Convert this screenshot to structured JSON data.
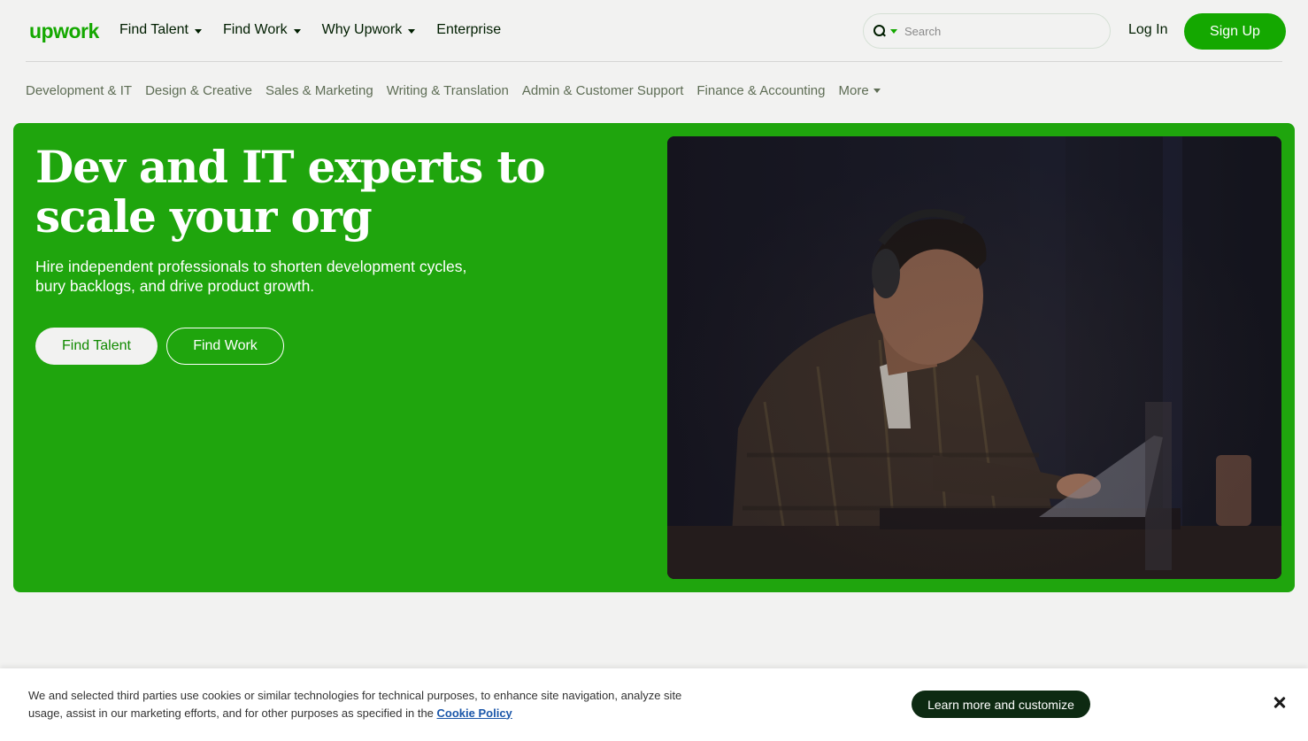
{
  "brand": {
    "logo_text": "upwork",
    "accent": "#14a800",
    "hero_green": "#1fa50d"
  },
  "header": {
    "nav": [
      {
        "label": "Find Talent",
        "has_dropdown": true
      },
      {
        "label": "Find Work",
        "has_dropdown": true
      },
      {
        "label": "Why Upwork",
        "has_dropdown": true
      },
      {
        "label": "Enterprise",
        "has_dropdown": false
      }
    ],
    "search": {
      "placeholder": "Search",
      "value": ""
    },
    "login_label": "Log In",
    "signup_label": "Sign Up"
  },
  "categories": [
    "Development & IT",
    "Design & Creative",
    "Sales & Marketing",
    "Writing & Translation",
    "Admin & Customer Support",
    "Finance & Accounting",
    "More"
  ],
  "hero": {
    "title_line1": "Dev and IT experts to",
    "title_line2": "scale your org",
    "subtitle_line1": "Hire independent professionals to shorten development cycles,",
    "subtitle_line2": "bury backlogs, and drive product growth.",
    "primary_button": "Find Talent",
    "secondary_button": "Find Work",
    "image_icon": "photo-developer-with-headphones-at-laptop"
  },
  "cookie_banner": {
    "text": "We and selected third parties use cookies or similar technologies for technical purposes, to enhance site navigation, analyze site usage, assist in our marketing efforts, and for other purposes as specified in the",
    "link_label": "Cookie Policy",
    "button_label": "Learn more and customize",
    "close_icon": "close-icon"
  }
}
